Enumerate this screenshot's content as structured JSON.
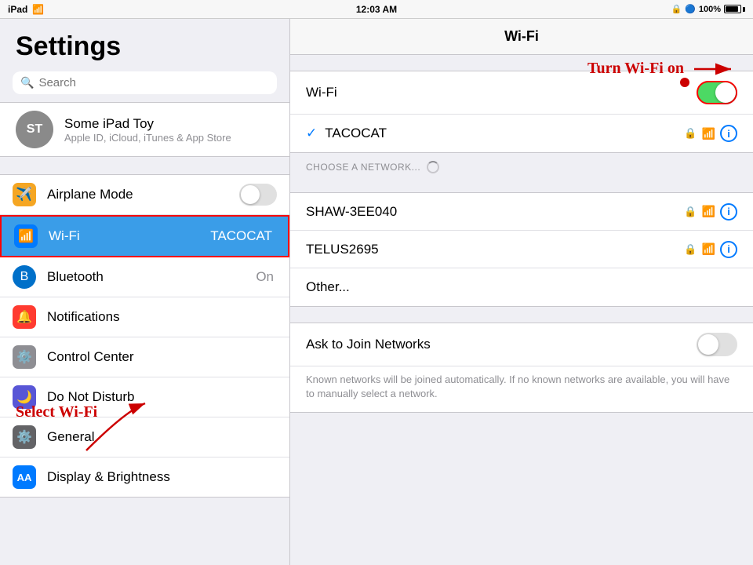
{
  "statusBar": {
    "left": "iPad",
    "time": "12:03 AM",
    "battery": "100%"
  },
  "sidebar": {
    "title": "Settings",
    "search": {
      "placeholder": "Search"
    },
    "user": {
      "initials": "ST",
      "name": "Some iPad Toy",
      "subtitle": "Apple ID, iCloud, iTunes & App Store"
    },
    "items": [
      {
        "id": "airplane",
        "label": "Airplane Mode",
        "icon": "✈",
        "iconBg": "icon-orange",
        "hasToggle": true
      },
      {
        "id": "wifi",
        "label": "Wi-Fi",
        "value": "TACOCAT",
        "icon": "📶",
        "iconBg": "icon-blue",
        "active": true
      },
      {
        "id": "bluetooth",
        "label": "Bluetooth",
        "value": "On",
        "icon": "🔵",
        "iconBg": "icon-blue-mid"
      },
      {
        "id": "notifications",
        "label": "Notifications",
        "icon": "🔴",
        "iconBg": "icon-red"
      },
      {
        "id": "controlcenter",
        "label": "Control Center",
        "icon": "⚙",
        "iconBg": "icon-gray"
      },
      {
        "id": "donotdisturb",
        "label": "Do Not Disturb",
        "icon": "🌙",
        "iconBg": "icon-purple"
      },
      {
        "id": "general",
        "label": "General",
        "icon": "⚙",
        "iconBg": "icon-dark"
      },
      {
        "id": "displaybrightness",
        "label": "Display & Brightness",
        "icon": "AA",
        "iconBg": "icon-aa"
      }
    ]
  },
  "content": {
    "header": "Wi-Fi",
    "wifiToggle": true,
    "connectedNetwork": "TACOCAT",
    "chooseNetworkLabel": "CHOOSE A NETWORK...",
    "networks": [
      {
        "name": "SHAW-3EE040",
        "locked": true,
        "signal": 2
      },
      {
        "name": "TELUS2695",
        "locked": true,
        "signal": 2
      }
    ],
    "otherLabel": "Other...",
    "askToJoin": {
      "label": "Ask to Join Networks",
      "description": "Known networks will be joined automatically. If no known networks are available, you will have to manually select a network."
    }
  },
  "annotations": {
    "turnWifiOn": "Turn Wi-Fi on",
    "selectWifi": "Select Wi-Fi"
  }
}
